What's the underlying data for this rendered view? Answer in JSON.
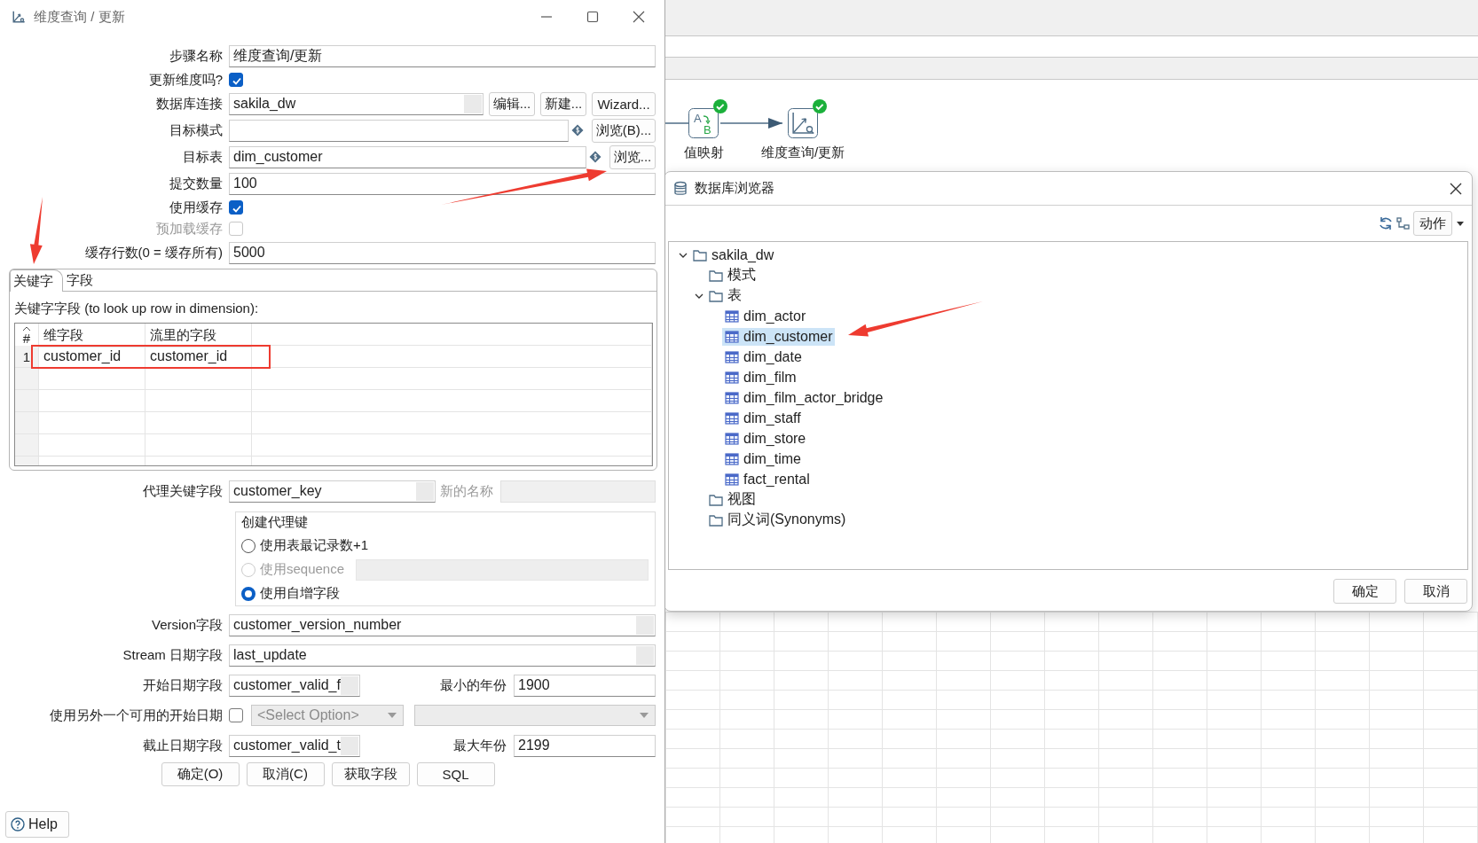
{
  "dialog": {
    "title": "维度查询 / 更新",
    "fields_top": [
      {
        "kind": "text",
        "label": "步骤名称",
        "value": "维度查询/更新"
      },
      {
        "kind": "check",
        "label": "更新维度吗?",
        "checked": true,
        "disabled": false
      },
      {
        "kind": "text",
        "label": "数据库连接",
        "value": "sakila_dw",
        "combo": true,
        "buttons": [
          "编辑...",
          "新建...",
          "Wizard..."
        ]
      },
      {
        "kind": "text",
        "label": "目标模式",
        "variable": true,
        "buttons": [
          "浏览(B)..."
        ]
      },
      {
        "kind": "text",
        "label": "目标表",
        "value": "dim_customer",
        "variable": true,
        "buttons": [
          "浏览..."
        ]
      },
      {
        "kind": "text",
        "label": "提交数量",
        "value": "100"
      },
      {
        "kind": "check",
        "label": "使用缓存",
        "checked": true,
        "disabled": false
      },
      {
        "kind": "check",
        "label": "预加载缓存",
        "checked": false,
        "disabled": true
      },
      {
        "kind": "text",
        "label": "缓存行数(0 = 缓存所有)",
        "value": "5000"
      }
    ],
    "tabs": [
      {
        "label": "关键字",
        "selected": true
      },
      {
        "label": "字段",
        "selected": false
      }
    ],
    "key_table": {
      "caption": "关键字字段 (to look up row in dimension):",
      "columns": [
        "#",
        "维字段",
        "流里的字段"
      ],
      "rows": [
        [
          "1",
          "customer_id",
          "customer_id"
        ]
      ]
    },
    "surrogate_key": {
      "label": "代理关键字段",
      "value": "customer_key",
      "new_name_label": "新的名称"
    },
    "create_key": {
      "title": "创建代理键",
      "options": [
        {
          "label": "使用表最记录数+1",
          "selected": false,
          "disabled": false
        },
        {
          "label": "使用sequence",
          "selected": false,
          "disabled": true,
          "with_field": true
        },
        {
          "label": "使用自增字段",
          "selected": true,
          "disabled": false
        }
      ]
    },
    "fields_bottom": [
      {
        "kind": "text",
        "label": "Version字段",
        "value": "customer_version_number",
        "combo": true
      },
      {
        "kind": "text",
        "label": "Stream 日期字段",
        "value": "last_update",
        "combo": true
      },
      {
        "kind": "date",
        "label": "开始日期字段",
        "value": "customer_valid_f",
        "year_label": "最小的年份",
        "year_value": "1900"
      },
      {
        "kind": "alt_date",
        "label": "使用另外一个可用的开始日期",
        "checked": false,
        "select_value": "<Select Option>"
      },
      {
        "kind": "date",
        "label": "截止日期字段",
        "value": "customer_valid_t",
        "year_label": "最大年份",
        "year_value": "2199"
      }
    ],
    "buttons": [
      "确定(O)",
      "取消(C)",
      "获取字段",
      "SQL"
    ],
    "help": "Help"
  },
  "canvas": {
    "steps": [
      {
        "kind": "value_mapper",
        "label": "值映射",
        "icon_letters": [
          "A",
          "B"
        ],
        "ok": true
      },
      {
        "kind": "dim_lookup",
        "label": "维度查询/更新",
        "ok": true
      }
    ]
  },
  "db_browser": {
    "title": "数据库浏览器",
    "action_button": "动作",
    "tree": [
      {
        "label": "sakila_dw",
        "kind": "folder",
        "expanded": true,
        "selected": false,
        "children": [
          {
            "label": "模式",
            "kind": "folder",
            "selected": false
          },
          {
            "label": "表",
            "kind": "folder",
            "expanded": true,
            "selected": false,
            "children": [
              {
                "label": "dim_actor",
                "kind": "table",
                "selected": false
              },
              {
                "label": "dim_customer",
                "kind": "table",
                "selected": true
              },
              {
                "label": "dim_date",
                "kind": "table",
                "selected": false
              },
              {
                "label": "dim_film",
                "kind": "table",
                "selected": false
              },
              {
                "label": "dim_film_actor_bridge",
                "kind": "table",
                "selected": false
              },
              {
                "label": "dim_staff",
                "kind": "table",
                "selected": false
              },
              {
                "label": "dim_store",
                "kind": "table",
                "selected": false
              },
              {
                "label": "dim_time",
                "kind": "table",
                "selected": false
              },
              {
                "label": "fact_rental",
                "kind": "table",
                "selected": false
              }
            ]
          },
          {
            "label": "视图",
            "kind": "folder",
            "selected": false
          },
          {
            "label": "同义词(Synonyms)",
            "kind": "folder",
            "selected": false
          }
        ]
      }
    ],
    "buttons": [
      "确定",
      "取消"
    ]
  }
}
